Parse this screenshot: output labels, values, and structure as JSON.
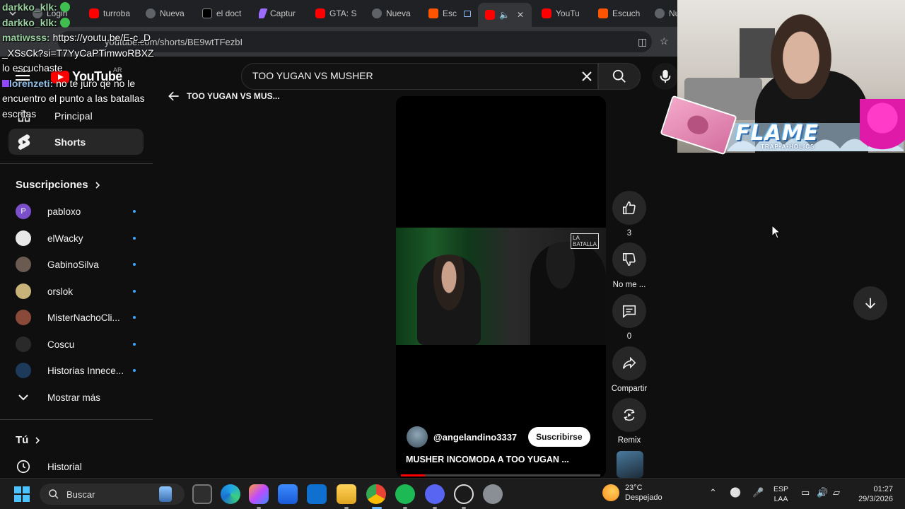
{
  "browser": {
    "tabs": [
      {
        "label": "Login",
        "favicon": "globe-icon"
      },
      {
        "label": "turroba",
        "favicon": "youtube-icon"
      },
      {
        "label": "Nueva",
        "favicon": "globe-icon"
      },
      {
        "label": "el doct",
        "favicon": "x-icon"
      },
      {
        "label": "Captur",
        "favicon": "pen-icon"
      },
      {
        "label": "GTA: Sa",
        "favicon": "youtube-icon"
      },
      {
        "label": "Nueva",
        "favicon": "globe-icon"
      },
      {
        "label": "Esc",
        "favicon": "soundcloud-icon"
      },
      {
        "label": "",
        "favicon": "youtube-icon"
      },
      {
        "label": "YouTu",
        "favicon": "youtube-icon"
      },
      {
        "label": "Escuch",
        "favicon": "soundcloud-icon"
      },
      {
        "label": "Nu",
        "favicon": "globe-icon"
      }
    ],
    "url": "youtube.com/shorts/BE9wtTFezbI"
  },
  "chat": [
    {
      "nick": "darkko_klk:",
      "msg": ""
    },
    {
      "nick": "darkko_klk:",
      "msg": ""
    },
    {
      "nick": "matiwsss:",
      "msg": "https://youtu.be/E-c_D_XSsCk?si=T7YyCaPTimwoRBXZ lo escuchaste"
    },
    {
      "nick": "lorenzeti:",
      "msg": "no te juro qe no le encuentro el punto a las batallas escritas"
    }
  ],
  "youtube": {
    "logo": "YouTube",
    "region": "AR",
    "search_query": "TOO YUGAN VS MUSHER",
    "back_title": "TOO YUGAN VS MUS..."
  },
  "sidebar": {
    "principal": "Principal",
    "shorts": "Shorts",
    "subs_heading": "Suscripciones",
    "subscriptions": [
      {
        "name": "pabloxo",
        "color": "#7b4fc9",
        "initial": "P"
      },
      {
        "name": "elWacky",
        "color": "#e8e8e8",
        "initial": ""
      },
      {
        "name": "GabinoSilva",
        "color": "#6b5a4f",
        "initial": ""
      },
      {
        "name": "orslok",
        "color": "#c8b27a",
        "initial": ""
      },
      {
        "name": "MisterNachoCli...",
        "color": "#8a4a3a",
        "initial": ""
      },
      {
        "name": "Coscu",
        "color": "#2a2a2a",
        "initial": ""
      },
      {
        "name": "Historias Innece...",
        "color": "#1e3a5a",
        "initial": ""
      }
    ],
    "show_more": "Mostrar más",
    "you_heading": "Tú",
    "history": "Historial"
  },
  "short": {
    "channel": "@angelandino3337",
    "subscribe": "Suscribirse",
    "title": "MUSHER INCOMODA A TOO YUGAN ...",
    "progress": 0.12,
    "frame_logo": "LA\nBATALLA"
  },
  "actions": {
    "likes": "3",
    "dislike_label": "No me ...",
    "comments": "0",
    "share": "Compartir",
    "remix": "Remix"
  },
  "overlay": {
    "brand": "FLAME",
    "brand_sub": "TRAP•A•HOLICS"
  },
  "taskbar": {
    "search_placeholder": "Buscar",
    "temp": "23°C",
    "weather": "Despejado",
    "lang1": "ESP",
    "lang2": "LAA",
    "time": "01:27",
    "date": "29/3/2026"
  },
  "colors": {
    "accent": "#ff0000",
    "dot": "#3ea6ff"
  }
}
